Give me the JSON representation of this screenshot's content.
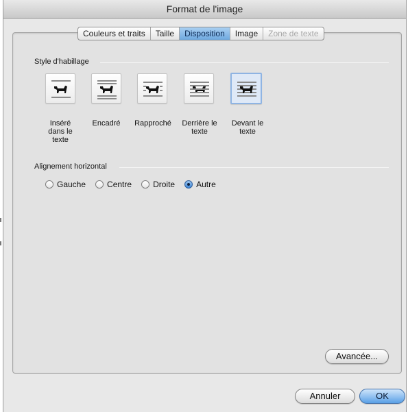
{
  "window": {
    "title": "Format de l'image"
  },
  "tabs": [
    {
      "label": "Couleurs et traits",
      "state": "normal"
    },
    {
      "label": "Taille",
      "state": "normal"
    },
    {
      "label": "Disposition",
      "state": "active"
    },
    {
      "label": "Image",
      "state": "normal"
    },
    {
      "label": "Zone de texte",
      "state": "disabled"
    }
  ],
  "wrap_style": {
    "title": "Style d'habillage",
    "options": [
      {
        "label": "Inséré dans le texte",
        "icon": "inline-with-text-icon",
        "selected": false
      },
      {
        "label": "Encadré",
        "icon": "square-wrap-icon",
        "selected": false
      },
      {
        "label": "Rapproché",
        "icon": "tight-wrap-icon",
        "selected": false
      },
      {
        "label": "Derrière le texte",
        "icon": "behind-text-icon",
        "selected": false
      },
      {
        "label": "Devant le texte",
        "icon": "in-front-of-text-icon",
        "selected": true
      }
    ]
  },
  "horizontal_alignment": {
    "title": "Alignement horizontal",
    "options": [
      {
        "label": "Gauche",
        "checked": false
      },
      {
        "label": "Centre",
        "checked": false
      },
      {
        "label": "Droite",
        "checked": false
      },
      {
        "label": "Autre",
        "checked": true
      }
    ]
  },
  "buttons": {
    "advanced": "Avancée...",
    "cancel": "Annuler",
    "ok": "OK"
  },
  "colors": {
    "accent": "#6ea8e0",
    "selected_option_bg": "#dfe9f7"
  }
}
